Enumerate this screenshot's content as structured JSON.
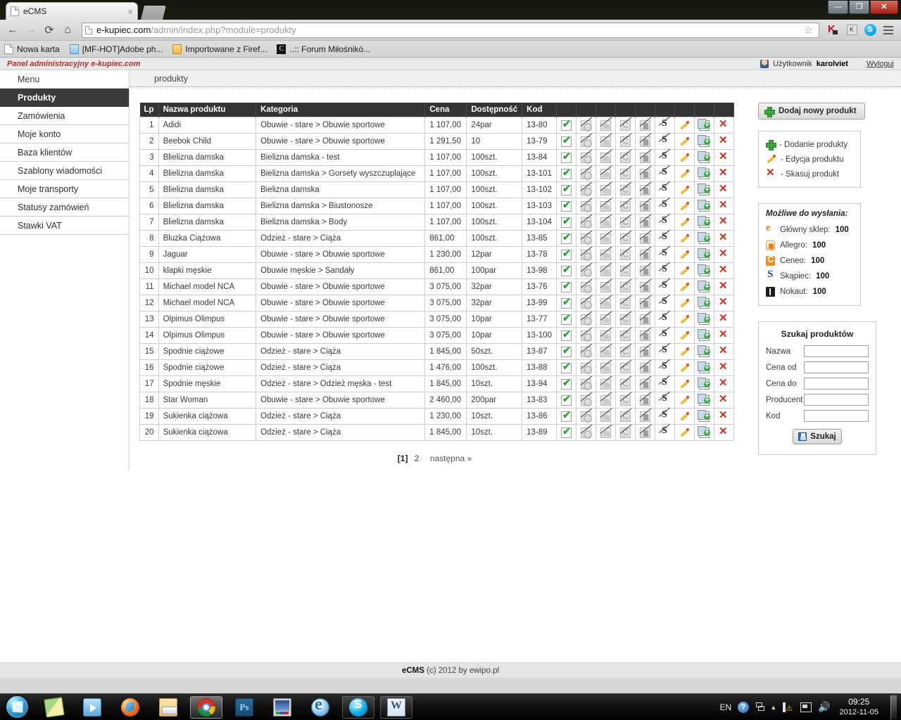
{
  "browser": {
    "tab_title": "eCMS",
    "tab_close": "×",
    "back_icon": "←",
    "forward_icon": "→",
    "reload_icon": "⟳",
    "home_icon": "⌂",
    "url_host": "e-kupiec.com",
    "url_path": "/admin/index.php?module=produkty",
    "star_icon": "☆",
    "extension_icons": [
      "kaspersky-icon",
      "k-meleon-icon",
      "skype-icon",
      "chrome-menu-icon"
    ],
    "window_buttons": {
      "minimize": "—",
      "maximize": "❐",
      "close": "✕"
    },
    "bookmarks": [
      {
        "label": "Nowa karta",
        "icon": "doc"
      },
      {
        "label": "[MF-HOT]Adobe ph...",
        "icon": "ps"
      },
      {
        "label": "Importowane z Firef...",
        "icon": "folder"
      },
      {
        "label": "..:: Forum Miłośnikó...",
        "icon": "forum"
      }
    ]
  },
  "adminbar": {
    "brand": "Panel administracyjny e-kupiec.com",
    "user_label": "Użytkownik",
    "user_name": "karolviet",
    "logout": "Wyloguj"
  },
  "sidebar": {
    "items": [
      {
        "label": "Menu",
        "active": false,
        "header": true
      },
      {
        "label": "Produkty",
        "active": true
      },
      {
        "label": "Zamówienia",
        "active": false
      },
      {
        "label": "Moje konto",
        "active": false
      },
      {
        "label": "Baza klientów",
        "active": false
      },
      {
        "label": "Szablony wiadomości",
        "active": false
      },
      {
        "label": "Moje transporty",
        "active": false
      },
      {
        "label": "Statusy zamówień",
        "active": false
      },
      {
        "label": "Stawki VAT",
        "active": false
      }
    ]
  },
  "breadcrumb": "produkty",
  "table": {
    "columns": [
      "Lp",
      "Nazwa produktu",
      "Kategoria",
      "Cena",
      "Dostępność",
      "Kod"
    ],
    "action_columns": [
      "shop-status",
      "allegro-status",
      "ceneo-status",
      "ceneo2-status",
      "nokaut-status",
      "skapiec-status",
      "edit",
      "copy",
      "delete"
    ],
    "rows": [
      {
        "lp": "1",
        "name": "Adidi",
        "category": "Obuwie - stare > Obuwie sportowe",
        "price": "1 107,00",
        "avail": "24par",
        "code": "13-80"
      },
      {
        "lp": "2",
        "name": "Beebok Child",
        "category": "Obuwie - stare > Obuwie sportowe",
        "price": "1 291,50",
        "avail": "10",
        "code": "13-79"
      },
      {
        "lp": "3",
        "name": "Blielizna damska",
        "category": "Bielizna damska - test",
        "price": "1 107,00",
        "avail": "100szt.",
        "code": "13-84"
      },
      {
        "lp": "4",
        "name": "Blielizna damska",
        "category": "Bielizna damska > Gorsety wyszczuplające",
        "price": "1 107,00",
        "avail": "100szt.",
        "code": "13-101"
      },
      {
        "lp": "5",
        "name": "Blielizna damska",
        "category": "Bielizna damska",
        "price": "1 107,00",
        "avail": "100szt.",
        "code": "13-102"
      },
      {
        "lp": "6",
        "name": "Blielizna damska",
        "category": "Bielizna damska > Biustonosze",
        "price": "1 107,00",
        "avail": "100szt.",
        "code": "13-103"
      },
      {
        "lp": "7",
        "name": "Blielizna damska",
        "category": "Bielizna damska > Body",
        "price": "1 107,00",
        "avail": "100szt.",
        "code": "13-104"
      },
      {
        "lp": "8",
        "name": "Bluzka Ciążowa",
        "category": "Odzież - stare > Ciąża",
        "price": "861,00",
        "avail": "100szt.",
        "code": "13-85"
      },
      {
        "lp": "9",
        "name": "Jaguar",
        "category": "Obuwie - stare > Obuwie sportowe",
        "price": "1 230,00",
        "avail": "12par",
        "code": "13-78"
      },
      {
        "lp": "10",
        "name": "klapki męskie",
        "category": "Obuwie męskie > Sandały",
        "price": "861,00",
        "avail": "100par",
        "code": "13-98"
      },
      {
        "lp": "11",
        "name": "Michael model NCA",
        "category": "Obuwie - stare > Obuwie sportowe",
        "price": "3 075,00",
        "avail": "32par",
        "code": "13-76"
      },
      {
        "lp": "12",
        "name": "Michael model NCA",
        "category": "Obuwie - stare > Obuwie sportowe",
        "price": "3 075,00",
        "avail": "32par",
        "code": "13-99"
      },
      {
        "lp": "13",
        "name": "Olpimus Olimpus",
        "category": "Obuwie - stare > Obuwie sportowe",
        "price": "3 075,00",
        "avail": "10par",
        "code": "13-77"
      },
      {
        "lp": "14",
        "name": "Olpimus Olimpus",
        "category": "Obuwie - stare > Obuwie sportowe",
        "price": "3 075,00",
        "avail": "10par",
        "code": "13-100"
      },
      {
        "lp": "15",
        "name": "Spodnie ciążowe",
        "category": "Odzież - stare > Ciąża",
        "price": "1 845,00",
        "avail": "50szt.",
        "code": "13-87"
      },
      {
        "lp": "16",
        "name": "Spodnie ciążowe",
        "category": "Odzież - stare > Ciąża",
        "price": "1 476,00",
        "avail": "100szt.",
        "code": "13-88"
      },
      {
        "lp": "17",
        "name": "Spodnie męskie",
        "category": "Odzież - stare > Odzież męska - test",
        "price": "1 845,00",
        "avail": "10szt.",
        "code": "13-94"
      },
      {
        "lp": "18",
        "name": "Star Woman",
        "category": "Obuwie - stare > Obuwie sportowe",
        "price": "2 460,00",
        "avail": "200par",
        "code": "13-83"
      },
      {
        "lp": "19",
        "name": "Sukienka ciążowa",
        "category": "Odzież - stare > Ciąża",
        "price": "1 230,00",
        "avail": "10szt.",
        "code": "13-86"
      },
      {
        "lp": "20",
        "name": "Sukienka ciążowa",
        "category": "Odzież - stare > Ciąża",
        "price": "1 845,00",
        "avail": "10szt.",
        "code": "13-89"
      }
    ]
  },
  "pager": {
    "current": "[1]",
    "next_page": "2",
    "next_label": "następna »"
  },
  "rightcol": {
    "add_button": "Dodaj nowy produkt",
    "legend": [
      {
        "icon": "plus-icon",
        "text": "- Dodanie produkty"
      },
      {
        "icon": "pencil-icon",
        "text": "- Edycja produktu"
      },
      {
        "icon": "delete-icon",
        "text": "- Skasuj produkt"
      }
    ],
    "send_panel": {
      "title": "Możliwe do wysłania:",
      "rows": [
        {
          "icon": "shop-icon",
          "label": "Główny sklep:",
          "count": "100"
        },
        {
          "icon": "allegro-icon",
          "label": "Allegro:",
          "count": "100"
        },
        {
          "icon": "ceneo-icon",
          "label": "Ceneo:",
          "count": "100"
        },
        {
          "icon": "skapiec-icon",
          "label": "Skąpiec:",
          "count": "100"
        },
        {
          "icon": "nokaut-icon",
          "label": "Nokaut:",
          "count": "100"
        }
      ]
    },
    "search_panel": {
      "title": "Szukaj produktów",
      "fields": [
        {
          "label": "Nazwa",
          "value": "",
          "placeholder": ""
        },
        {
          "label": "Cena od",
          "value": "",
          "placeholder": ""
        },
        {
          "label": "Cena do",
          "value": "",
          "placeholder": ""
        },
        {
          "label": "Producent",
          "value": "",
          "placeholder": ""
        },
        {
          "label": "Kod",
          "value": "",
          "placeholder": ""
        }
      ],
      "button": "Szukaj"
    }
  },
  "footer": {
    "brand": "eCMS",
    "text": "(c) 2012 by ewipo.pl"
  },
  "taskbar": {
    "start": "start-orb-icon",
    "items": [
      "sticky-notes-icon",
      "windows-media-player-icon",
      "firefox-icon",
      "windows-explorer-icon",
      "chrome-icon",
      "photoshop-icon",
      "video-editor-icon",
      "internet-explorer-icon",
      "skype-icon",
      "word-icon"
    ],
    "tray": {
      "language": "EN",
      "help": "?",
      "time": "09:25",
      "date": "2012-11-05"
    }
  },
  "colors": {
    "menu_active_bg": "#3b3b3b",
    "table_header_bg": "#343434",
    "brand_red": "#b03030",
    "delete_red": "#d32f1e",
    "ok_green": "#25a433",
    "accent_orange": "#f08a1c"
  }
}
